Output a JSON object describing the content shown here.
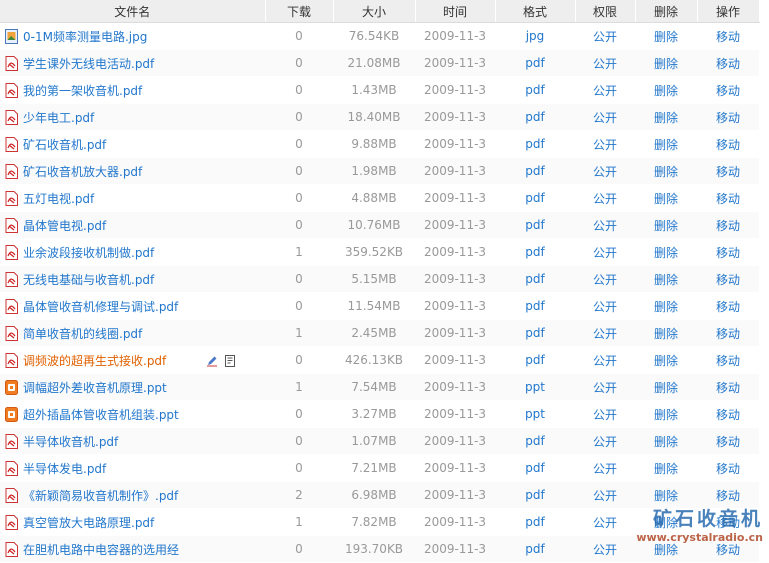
{
  "headers": {
    "name": "文件名",
    "downloads": "下载",
    "size": "大小",
    "date": "时间",
    "format": "格式",
    "permission": "权限",
    "delete": "删除",
    "operation": "操作"
  },
  "rows": [
    {
      "icon": "jpg",
      "name": "0-1M频率测量电路.jpg",
      "downloads": "0",
      "size": "76.54KB",
      "date": "2009-11-3",
      "format": "jpg",
      "permission": "公开",
      "delete": "删除",
      "operation": "移动"
    },
    {
      "icon": "pdf",
      "name": "学生课外无线电活动.pdf",
      "downloads": "0",
      "size": "21.08MB",
      "date": "2009-11-3",
      "format": "pdf",
      "permission": "公开",
      "delete": "删除",
      "operation": "移动"
    },
    {
      "icon": "pdf",
      "name": "我的第一架收音机.pdf",
      "downloads": "0",
      "size": "1.43MB",
      "date": "2009-11-3",
      "format": "pdf",
      "permission": "公开",
      "delete": "删除",
      "operation": "移动"
    },
    {
      "icon": "pdf",
      "name": "少年电工.pdf",
      "downloads": "0",
      "size": "18.40MB",
      "date": "2009-11-3",
      "format": "pdf",
      "permission": "公开",
      "delete": "删除",
      "operation": "移动"
    },
    {
      "icon": "pdf",
      "name": "矿石收音机.pdf",
      "downloads": "0",
      "size": "9.88MB",
      "date": "2009-11-3",
      "format": "pdf",
      "permission": "公开",
      "delete": "删除",
      "operation": "移动"
    },
    {
      "icon": "pdf",
      "name": "矿石收音机放大器.pdf",
      "downloads": "0",
      "size": "1.98MB",
      "date": "2009-11-3",
      "format": "pdf",
      "permission": "公开",
      "delete": "删除",
      "operation": "移动"
    },
    {
      "icon": "pdf",
      "name": "五灯电视.pdf",
      "downloads": "0",
      "size": "4.88MB",
      "date": "2009-11-3",
      "format": "pdf",
      "permission": "公开",
      "delete": "删除",
      "operation": "移动"
    },
    {
      "icon": "pdf",
      "name": "晶体管电视.pdf",
      "downloads": "0",
      "size": "10.76MB",
      "date": "2009-11-3",
      "format": "pdf",
      "permission": "公开",
      "delete": "删除",
      "operation": "移动"
    },
    {
      "icon": "pdf",
      "name": "业余波段接收机制做.pdf",
      "downloads": "1",
      "size": "359.52KB",
      "date": "2009-11-3",
      "format": "pdf",
      "permission": "公开",
      "delete": "删除",
      "operation": "移动"
    },
    {
      "icon": "pdf",
      "name": "无线电基础与收音机.pdf",
      "downloads": "0",
      "size": "5.15MB",
      "date": "2009-11-3",
      "format": "pdf",
      "permission": "公开",
      "delete": "删除",
      "operation": "移动"
    },
    {
      "icon": "pdf",
      "name": "晶体管收音机修理与调试.pdf",
      "downloads": "0",
      "size": "11.54MB",
      "date": "2009-11-3",
      "format": "pdf",
      "permission": "公开",
      "delete": "删除",
      "operation": "移动"
    },
    {
      "icon": "pdf",
      "name": "简单收音机的线圈.pdf",
      "downloads": "1",
      "size": "2.45MB",
      "date": "2009-11-3",
      "format": "pdf",
      "permission": "公开",
      "delete": "删除",
      "operation": "移动"
    },
    {
      "icon": "pdf",
      "name": "调频波的超再生式接收.pdf",
      "downloads": "0",
      "size": "426.13KB",
      "date": "2009-11-3",
      "format": "pdf",
      "permission": "公开",
      "delete": "删除",
      "operation": "移动",
      "highlight": true
    },
    {
      "icon": "ppt",
      "name": "调幅超外差收音机原理.ppt",
      "downloads": "1",
      "size": "7.54MB",
      "date": "2009-11-3",
      "format": "ppt",
      "permission": "公开",
      "delete": "删除",
      "operation": "移动"
    },
    {
      "icon": "ppt",
      "name": "超外插晶体管收音机组装.ppt",
      "downloads": "0",
      "size": "3.27MB",
      "date": "2009-11-3",
      "format": "ppt",
      "permission": "公开",
      "delete": "删除",
      "operation": "移动"
    },
    {
      "icon": "pdf",
      "name": "半导体收音机.pdf",
      "downloads": "0",
      "size": "1.07MB",
      "date": "2009-11-3",
      "format": "pdf",
      "permission": "公开",
      "delete": "删除",
      "operation": "移动"
    },
    {
      "icon": "pdf",
      "name": "半导体发电.pdf",
      "downloads": "0",
      "size": "7.21MB",
      "date": "2009-11-3",
      "format": "pdf",
      "permission": "公开",
      "delete": "删除",
      "operation": "移动"
    },
    {
      "icon": "pdf",
      "name": "《新颖简易收音机制作》.pdf",
      "downloads": "2",
      "size": "6.98MB",
      "date": "2009-11-3",
      "format": "pdf",
      "permission": "公开",
      "delete": "删除",
      "operation": "移动"
    },
    {
      "icon": "pdf",
      "name": "真空管放大电路原理.pdf",
      "downloads": "1",
      "size": "7.82MB",
      "date": "2009-11-3",
      "format": "pdf",
      "permission": "公开",
      "delete": "删除",
      "operation": "移动"
    },
    {
      "icon": "pdf",
      "name": "在胆机电路中电容器的选用经",
      "downloads": "0",
      "size": "193.70KB",
      "date": "2009-11-3",
      "format": "pdf",
      "permission": "公开",
      "delete": "删除",
      "operation": "移动"
    }
  ],
  "watermark": {
    "title": "矿石收音机",
    "url": "www.crystalradio.cn"
  },
  "colors": {
    "link": "#2277cc",
    "highlight": "#e06000",
    "header_bg": "#eeeeee",
    "muted": "#999999"
  }
}
